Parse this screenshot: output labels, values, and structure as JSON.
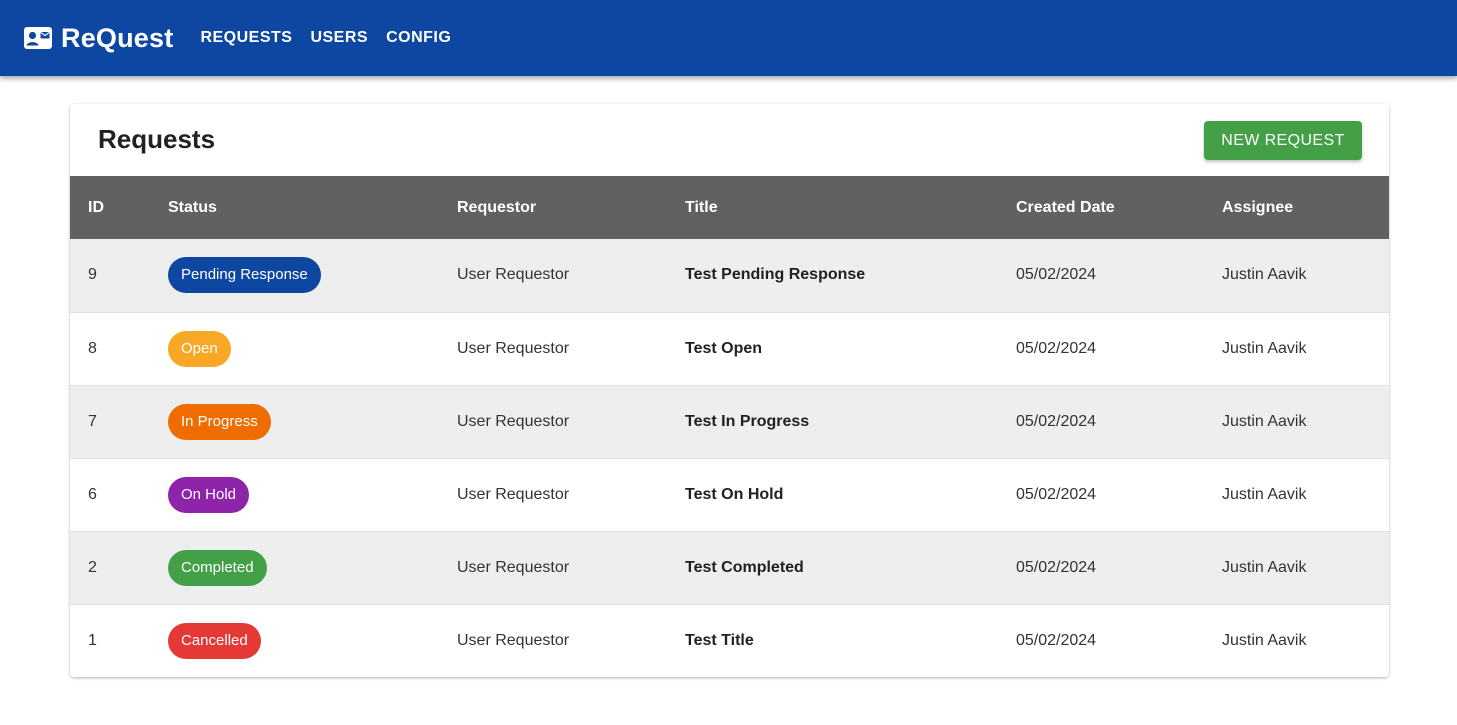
{
  "app": {
    "brand": "ReQuest",
    "brand_icon": "contact-card-icon",
    "nav": [
      "REQUESTS",
      "USERS",
      "CONFIG"
    ]
  },
  "page": {
    "title": "Requests",
    "new_button_label": "NEW REQUEST"
  },
  "table": {
    "columns": [
      "ID",
      "Status",
      "Requestor",
      "Title",
      "Created Date",
      "Assignee"
    ],
    "rows": [
      {
        "id": "9",
        "status": "Pending Response",
        "status_color": "#0d47a1",
        "requestor": "User Requestor",
        "title": "Test Pending Response",
        "created": "05/02/2024",
        "assignee": "Justin Aavik"
      },
      {
        "id": "8",
        "status": "Open",
        "status_color": "#f9a825",
        "requestor": "User Requestor",
        "title": "Test Open",
        "created": "05/02/2024",
        "assignee": "Justin Aavik"
      },
      {
        "id": "7",
        "status": "In Progress",
        "status_color": "#ef6c00",
        "requestor": "User Requestor",
        "title": "Test In Progress",
        "created": "05/02/2024",
        "assignee": "Justin Aavik"
      },
      {
        "id": "6",
        "status": "On Hold",
        "status_color": "#8e24aa",
        "requestor": "User Requestor",
        "title": "Test On Hold",
        "created": "05/02/2024",
        "assignee": "Justin Aavik"
      },
      {
        "id": "2",
        "status": "Completed",
        "status_color": "#43a047",
        "requestor": "User Requestor",
        "title": "Test Completed",
        "created": "05/02/2024",
        "assignee": "Justin Aavik"
      },
      {
        "id": "1",
        "status": "Cancelled",
        "status_color": "#e53935",
        "requestor": "User Requestor",
        "title": "Test Title",
        "created": "05/02/2024",
        "assignee": "Justin Aavik"
      }
    ]
  },
  "colors": {
    "appbar": "#0d47a1",
    "header_row": "#616161",
    "new_button": "#43a047"
  }
}
